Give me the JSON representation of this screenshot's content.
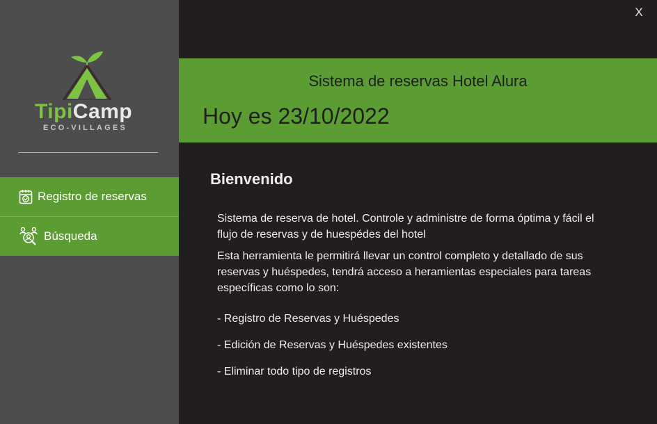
{
  "sidebar": {
    "logo": {
      "name_part1": "Tipi",
      "name_part2": "Camp",
      "subtitle": "ECO-VILLAGES"
    },
    "items": [
      {
        "label": "Registro de reservas",
        "icon": "calendar-check-icon"
      },
      {
        "label": "Búsqueda",
        "icon": "user-search-icon"
      }
    ]
  },
  "window": {
    "close_label": "X"
  },
  "banner": {
    "title": "Sistema de reservas Hotel Alura",
    "date": "Hoy es 23/10/2022"
  },
  "main": {
    "welcome": "Bienvenido",
    "paragraph1": "Sistema de reserva de hotel. Controle y administre de forma óptima y fácil el flujo de reservas y de huespédes del hotel",
    "paragraph2": "Esta herramienta le permitirá llevar un control completo y detallado de sus reservas y huéspedes, tendrá acceso a heramientas especiales para tareas específicas como lo son:",
    "bullets": [
      "- Registro de Reservas y Huéspedes",
      "- Edición de Reservas y Huéspedes existentes",
      "- Eliminar todo tipo de registros"
    ]
  },
  "colors": {
    "accent_green": "#5b9c33",
    "sidebar_bg": "#4d4d4d",
    "content_bg": "#221e1f",
    "logo_green": "#7dc242"
  }
}
